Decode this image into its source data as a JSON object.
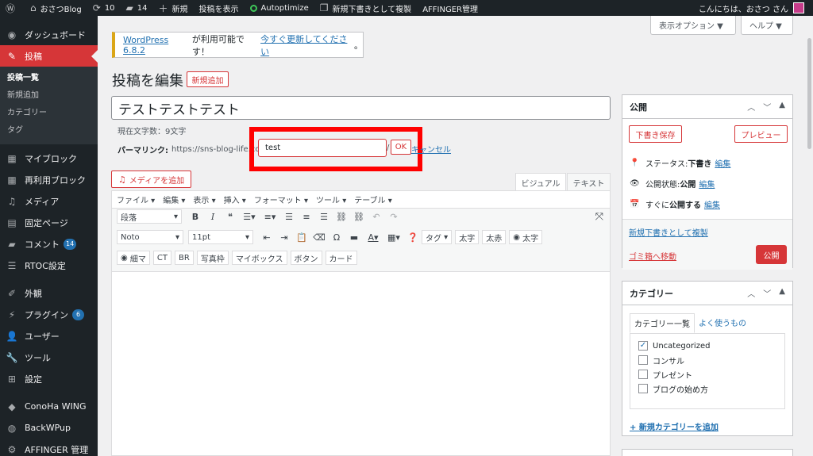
{
  "admin_bar": {
    "site_name": "おさつBlog",
    "updates_count": "10",
    "comments_count": "14",
    "new_label": "新規",
    "view_post_label": "投稿を表示",
    "autoptimize_label": "Autoptimize",
    "duplicate_label": "新規下書きとして複製",
    "affinger_label": "AFFINGER管理",
    "greeting": "こんにちは、おさつ さん"
  },
  "sidebar": {
    "dashboard": "ダッシュボード",
    "posts": "投稿",
    "submenu": [
      "投稿一覧",
      "新規追加",
      "カテゴリー",
      "タグ"
    ],
    "myblock": "マイブロック",
    "reusable": "再利用ブロック",
    "media": "メディア",
    "pages": "固定ページ",
    "comments": "コメント",
    "comments_badge": "14",
    "rtoc": "RTOC設定",
    "appearance": "外観",
    "plugins": "プラグイン",
    "plugins_badge": "6",
    "users": "ユーザー",
    "tools": "ツール",
    "settings": "設定",
    "conoha": "ConoHa WING",
    "backwpup": "BackWPup",
    "affinger": "AFFINGER 管理"
  },
  "screen_options": {
    "label": "表示オプション ▼",
    "help": "ヘルプ ▼"
  },
  "notice": {
    "version": "WordPress 6.8.2",
    "text": " が利用可能です！",
    "link": "今すぐ更新してください",
    "end": "。"
  },
  "page": {
    "title": "投稿を編集",
    "add_new": "新規追加"
  },
  "post": {
    "title": "テストテストテスト",
    "char_count": "現在文字数：9文字",
    "permalink_label": "パーマリンク:",
    "permalink_url": "https://sns-blog-life.com/",
    "slug": "test",
    "slash": "/",
    "ok": "OK",
    "cancel": "キャンセル"
  },
  "editor": {
    "add_media": "メディアを追加",
    "tab_visual": "ビジュアル",
    "tab_text": "テキスト",
    "menus": [
      "ファイル ▾",
      "編集 ▾",
      "表示 ▾",
      "挿入 ▾",
      "フォーマット ▾",
      "ツール ▾",
      "テーブル ▾"
    ],
    "paragraph": "段落",
    "font": "Noto",
    "size": "11pt",
    "tag": "タグ",
    "buttons_row2": [
      "太字",
      "太赤",
      "太字"
    ],
    "buttons_row3": [
      "細マ",
      "CT",
      "BR",
      "写真枠",
      "マイボックス",
      "ボタン",
      "カード"
    ]
  },
  "publish": {
    "title": "公開",
    "save_draft": "下書き保存",
    "preview": "プレビュー",
    "status_label": "ステータス: ",
    "status_value": "下書き",
    "visibility_label": "公開状態: ",
    "visibility_value": "公開",
    "schedule_label": "すぐに",
    "schedule_value": "公開する",
    "edit": "編集",
    "duplicate": "新規下書きとして複製",
    "trash": "ゴミ箱へ移動",
    "publish": "公開"
  },
  "categories": {
    "title": "カテゴリー",
    "tab_all": "カテゴリー一覧",
    "tab_popular": "よく使うもの",
    "items": [
      {
        "label": "Uncategorized",
        "checked": true
      },
      {
        "label": "コンサル",
        "checked": false
      },
      {
        "label": "プレゼント",
        "checked": false
      },
      {
        "label": "ブログの始め方",
        "checked": false
      }
    ],
    "add_new": "+ 新規カテゴリーを追加"
  }
}
